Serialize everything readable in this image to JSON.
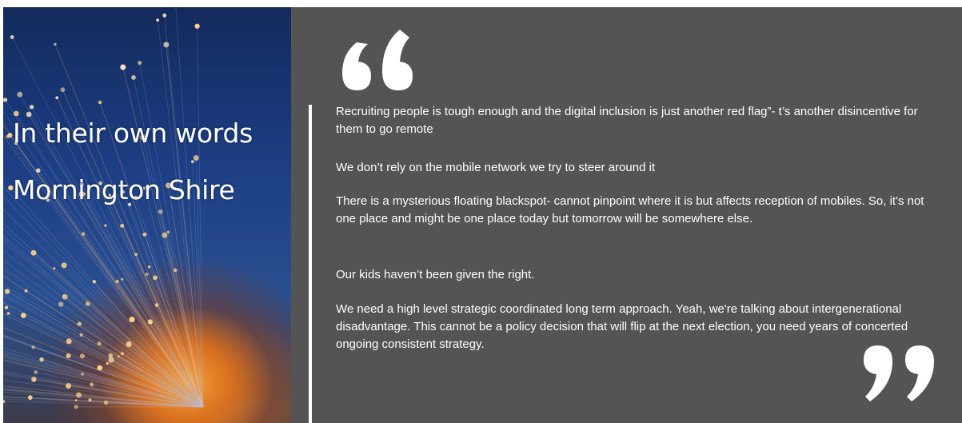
{
  "banner": {
    "title_line1": "In their own words",
    "title_line2": "Mornington Shire"
  },
  "quotes": [
    "Recruiting people is tough enough and the digital inclusion is just another red flag”- t’s another disincentive for them to go remote",
    "We don’t rely on the mobile network we try to steer around it",
    "There is a mysterious floating blackspot- cannot pinpoint where it is but affects reception of mobiles. So, it's not one place and might be one place today but tomorrow will be somewhere else.",
    "Our kids haven’t been given the right.",
    "We need a high level strategic coordinated long term approach. Yeah, we're talking about intergenerational disadvantage. This cannot be a policy decision that will flip at the next election, you need years of concerted ongoing consistent strategy."
  ],
  "icons": {
    "open": "opening-quote-icon",
    "close": "closing-quote-icon",
    "background": "fiber-optic-photo"
  },
  "colors": {
    "panel_bg": "#545454",
    "text": "#ffffff"
  }
}
